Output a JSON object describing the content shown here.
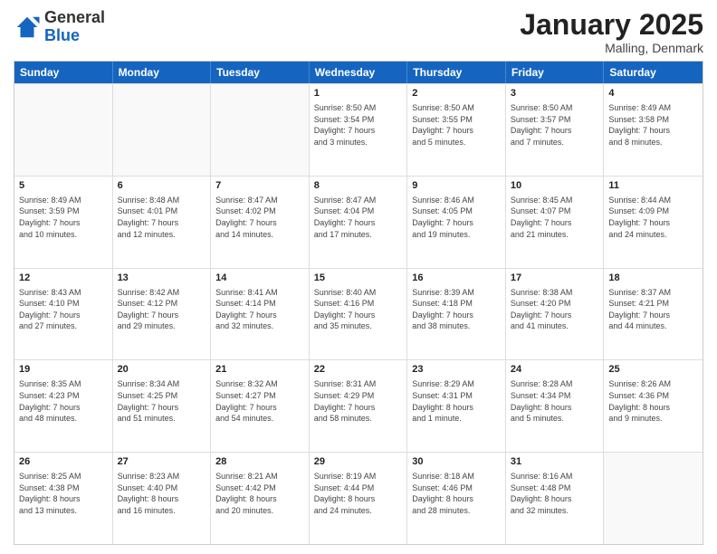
{
  "header": {
    "logo_general": "General",
    "logo_blue": "Blue",
    "month_title": "January 2025",
    "location": "Malling, Denmark"
  },
  "weekdays": [
    "Sunday",
    "Monday",
    "Tuesday",
    "Wednesday",
    "Thursday",
    "Friday",
    "Saturday"
  ],
  "rows": [
    [
      {
        "day": "",
        "info": ""
      },
      {
        "day": "",
        "info": ""
      },
      {
        "day": "",
        "info": ""
      },
      {
        "day": "1",
        "info": "Sunrise: 8:50 AM\nSunset: 3:54 PM\nDaylight: 7 hours\nand 3 minutes."
      },
      {
        "day": "2",
        "info": "Sunrise: 8:50 AM\nSunset: 3:55 PM\nDaylight: 7 hours\nand 5 minutes."
      },
      {
        "day": "3",
        "info": "Sunrise: 8:50 AM\nSunset: 3:57 PM\nDaylight: 7 hours\nand 7 minutes."
      },
      {
        "day": "4",
        "info": "Sunrise: 8:49 AM\nSunset: 3:58 PM\nDaylight: 7 hours\nand 8 minutes."
      }
    ],
    [
      {
        "day": "5",
        "info": "Sunrise: 8:49 AM\nSunset: 3:59 PM\nDaylight: 7 hours\nand 10 minutes."
      },
      {
        "day": "6",
        "info": "Sunrise: 8:48 AM\nSunset: 4:01 PM\nDaylight: 7 hours\nand 12 minutes."
      },
      {
        "day": "7",
        "info": "Sunrise: 8:47 AM\nSunset: 4:02 PM\nDaylight: 7 hours\nand 14 minutes."
      },
      {
        "day": "8",
        "info": "Sunrise: 8:47 AM\nSunset: 4:04 PM\nDaylight: 7 hours\nand 17 minutes."
      },
      {
        "day": "9",
        "info": "Sunrise: 8:46 AM\nSunset: 4:05 PM\nDaylight: 7 hours\nand 19 minutes."
      },
      {
        "day": "10",
        "info": "Sunrise: 8:45 AM\nSunset: 4:07 PM\nDaylight: 7 hours\nand 21 minutes."
      },
      {
        "day": "11",
        "info": "Sunrise: 8:44 AM\nSunset: 4:09 PM\nDaylight: 7 hours\nand 24 minutes."
      }
    ],
    [
      {
        "day": "12",
        "info": "Sunrise: 8:43 AM\nSunset: 4:10 PM\nDaylight: 7 hours\nand 27 minutes."
      },
      {
        "day": "13",
        "info": "Sunrise: 8:42 AM\nSunset: 4:12 PM\nDaylight: 7 hours\nand 29 minutes."
      },
      {
        "day": "14",
        "info": "Sunrise: 8:41 AM\nSunset: 4:14 PM\nDaylight: 7 hours\nand 32 minutes."
      },
      {
        "day": "15",
        "info": "Sunrise: 8:40 AM\nSunset: 4:16 PM\nDaylight: 7 hours\nand 35 minutes."
      },
      {
        "day": "16",
        "info": "Sunrise: 8:39 AM\nSunset: 4:18 PM\nDaylight: 7 hours\nand 38 minutes."
      },
      {
        "day": "17",
        "info": "Sunrise: 8:38 AM\nSunset: 4:20 PM\nDaylight: 7 hours\nand 41 minutes."
      },
      {
        "day": "18",
        "info": "Sunrise: 8:37 AM\nSunset: 4:21 PM\nDaylight: 7 hours\nand 44 minutes."
      }
    ],
    [
      {
        "day": "19",
        "info": "Sunrise: 8:35 AM\nSunset: 4:23 PM\nDaylight: 7 hours\nand 48 minutes."
      },
      {
        "day": "20",
        "info": "Sunrise: 8:34 AM\nSunset: 4:25 PM\nDaylight: 7 hours\nand 51 minutes."
      },
      {
        "day": "21",
        "info": "Sunrise: 8:32 AM\nSunset: 4:27 PM\nDaylight: 7 hours\nand 54 minutes."
      },
      {
        "day": "22",
        "info": "Sunrise: 8:31 AM\nSunset: 4:29 PM\nDaylight: 7 hours\nand 58 minutes."
      },
      {
        "day": "23",
        "info": "Sunrise: 8:29 AM\nSunset: 4:31 PM\nDaylight: 8 hours\nand 1 minute."
      },
      {
        "day": "24",
        "info": "Sunrise: 8:28 AM\nSunset: 4:34 PM\nDaylight: 8 hours\nand 5 minutes."
      },
      {
        "day": "25",
        "info": "Sunrise: 8:26 AM\nSunset: 4:36 PM\nDaylight: 8 hours\nand 9 minutes."
      }
    ],
    [
      {
        "day": "26",
        "info": "Sunrise: 8:25 AM\nSunset: 4:38 PM\nDaylight: 8 hours\nand 13 minutes."
      },
      {
        "day": "27",
        "info": "Sunrise: 8:23 AM\nSunset: 4:40 PM\nDaylight: 8 hours\nand 16 minutes."
      },
      {
        "day": "28",
        "info": "Sunrise: 8:21 AM\nSunset: 4:42 PM\nDaylight: 8 hours\nand 20 minutes."
      },
      {
        "day": "29",
        "info": "Sunrise: 8:19 AM\nSunset: 4:44 PM\nDaylight: 8 hours\nand 24 minutes."
      },
      {
        "day": "30",
        "info": "Sunrise: 8:18 AM\nSunset: 4:46 PM\nDaylight: 8 hours\nand 28 minutes."
      },
      {
        "day": "31",
        "info": "Sunrise: 8:16 AM\nSunset: 4:48 PM\nDaylight: 8 hours\nand 32 minutes."
      },
      {
        "day": "",
        "info": ""
      }
    ]
  ]
}
